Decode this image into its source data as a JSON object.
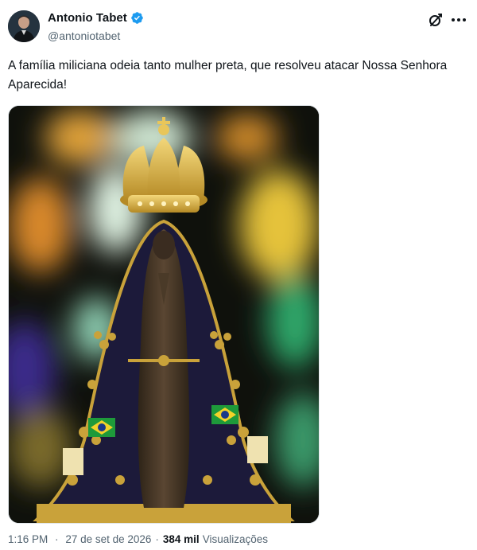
{
  "author": {
    "display_name": "Antonio Tabet",
    "handle": "@antoniotabet",
    "verified": true,
    "verified_color": "#1d9bf0"
  },
  "post": {
    "text": "A família miliciana odeia tanto mulher preta, que resolveu atacar Nossa Senhora Aparecida!",
    "media": {
      "type": "photo",
      "icon": "photo-statue-icon"
    }
  },
  "header_icons": [
    "grok-icon",
    "more-icon"
  ],
  "meta": {
    "time": "1:16 PM",
    "separator": "·",
    "date": "27 de set de 2026",
    "views_count": "384 mil",
    "views_label": "Visualizações"
  },
  "colors": {
    "text_primary": "#0f1419",
    "text_secondary": "#536471",
    "accent": "#1d9bf0",
    "gold": "#c9a23a",
    "mantle": "#1c1a3a"
  }
}
